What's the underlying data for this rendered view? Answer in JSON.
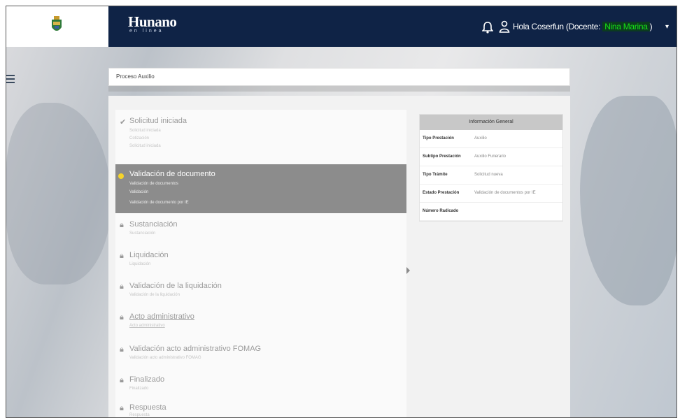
{
  "header": {
    "brand_name": "Hunano",
    "brand_sub": "en linea",
    "greeting_prefix": "Hola Coserfun (Docente: ",
    "docente_name": "Nina Marina",
    "greeting_suffix": ")",
    "caret": "▾"
  },
  "breadcrumb": "Proceso Auxilio",
  "steps": [
    {
      "title": "Solicitud iniciada",
      "subs": [
        "Solicitud iniciada",
        "Cotización",
        "Solicitud iniciada"
      ],
      "state": "done"
    },
    {
      "title": "Validación de documento",
      "subs": [
        "Validación de documentos",
        "Validación",
        "Validación de documento por IE"
      ],
      "state": "active"
    },
    {
      "title": "Sustanciación",
      "subs": [
        "Sustanciación"
      ],
      "state": "locked"
    },
    {
      "title": "Liquidación",
      "subs": [
        "Liquidación"
      ],
      "state": "locked"
    },
    {
      "title": "Validación de la liquidación",
      "subs": [
        "Validación de la liquidación"
      ],
      "state": "locked"
    },
    {
      "title": "Acto administrativo",
      "subs": [
        "Acto administrativo"
      ],
      "state": "locked"
    },
    {
      "title": "Validación acto administrativo FOMAG",
      "subs": [
        "Validación acto administrativo FOMAG"
      ],
      "state": "locked"
    },
    {
      "title": "Finalizado",
      "subs": [
        "Finalizado"
      ],
      "state": "locked"
    },
    {
      "title": "Respuesta",
      "subs": [
        "Respuesta"
      ],
      "state": "locked"
    }
  ],
  "info": {
    "header": "Información General",
    "rows": [
      {
        "k": "Tipo Prestación",
        "v": "Auxilio"
      },
      {
        "k": "Subtipo Prestación",
        "v": "Auxilio Funerario"
      },
      {
        "k": "Tipo Trámite",
        "v": "Solicitud nueva"
      },
      {
        "k": "Estado Prestación",
        "v": "Validación de documentos por IE"
      },
      {
        "k": "Número Radicado",
        "v": ""
      }
    ]
  }
}
